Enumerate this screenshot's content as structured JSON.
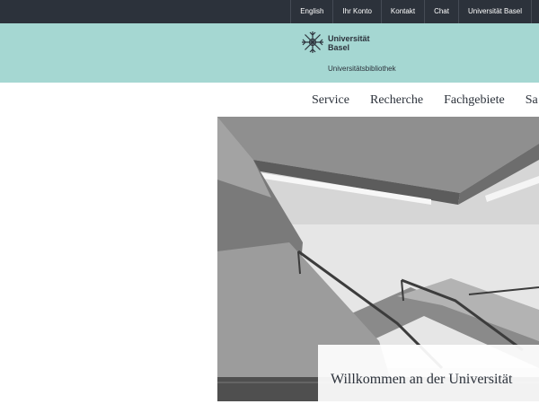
{
  "topnav": {
    "items": [
      {
        "label": "English"
      },
      {
        "label": "Ihr Konto"
      },
      {
        "label": "Kontakt"
      },
      {
        "label": "Chat"
      },
      {
        "label": "Universität Basel"
      }
    ]
  },
  "brand": {
    "name_line1": "Universität",
    "name_line2": "Basel",
    "subtitle": "Universitätsbibliothek",
    "accent_color": "#a5d7d2",
    "topbar_color": "#2c323b"
  },
  "mainnav": {
    "items": [
      {
        "label": "Service"
      },
      {
        "label": "Recherche"
      },
      {
        "label": "Fachgebiete"
      },
      {
        "label": "Sa"
      }
    ]
  },
  "hero": {
    "image": "staircase-photo",
    "headline": "Willkommen an der Universität"
  }
}
